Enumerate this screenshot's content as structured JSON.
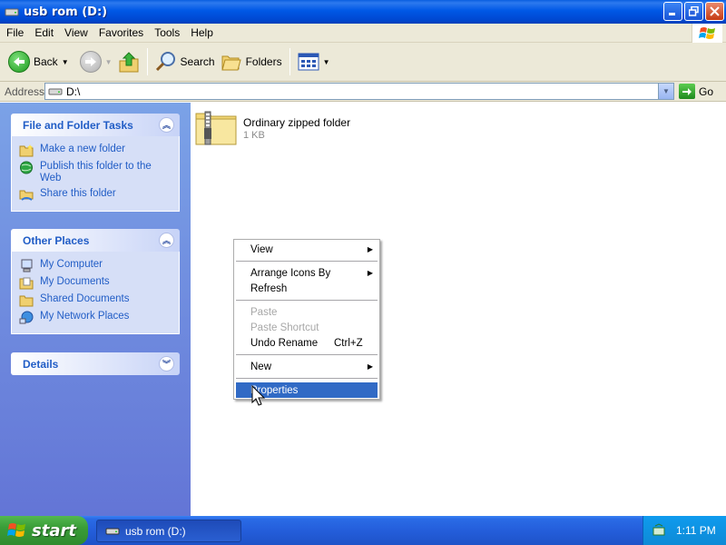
{
  "window": {
    "title": "usb rom (D:)"
  },
  "menu": [
    "File",
    "Edit",
    "View",
    "Favorites",
    "Tools",
    "Help"
  ],
  "toolbar": {
    "back": "Back",
    "search": "Search",
    "folders": "Folders"
  },
  "address": {
    "label": "Address",
    "value": "D:\\",
    "go": "Go"
  },
  "tasks_panel": {
    "title": "File and Folder Tasks",
    "items": [
      {
        "label": "Make a new folder",
        "icon": "new-folder-icon"
      },
      {
        "label": "Publish this folder to the Web",
        "icon": "globe-icon"
      },
      {
        "label": "Share this folder",
        "icon": "share-folder-icon"
      }
    ]
  },
  "places_panel": {
    "title": "Other Places",
    "items": [
      {
        "label": "My Computer",
        "icon": "computer-icon"
      },
      {
        "label": "My Documents",
        "icon": "documents-icon"
      },
      {
        "label": "Shared Documents",
        "icon": "shared-folder-icon"
      },
      {
        "label": "My Network Places",
        "icon": "network-icon"
      }
    ]
  },
  "details_panel": {
    "title": "Details"
  },
  "file": {
    "name": "Ordinary zipped folder",
    "size": "1 KB"
  },
  "context_menu": {
    "view": "View",
    "arrange": "Arrange Icons By",
    "refresh": "Refresh",
    "paste": "Paste",
    "paste_shortcut": "Paste Shortcut",
    "undo": "Undo Rename",
    "undo_shortcut": "Ctrl+Z",
    "new": "New",
    "properties": "Properties",
    "selected": "Properties"
  },
  "taskbar": {
    "start": "start",
    "window_button": "usb rom (D:)",
    "clock": "1:11 PM"
  },
  "colors": {
    "selection": "#316ac5",
    "link": "#215dc6",
    "titlebar": "#0058e6"
  }
}
